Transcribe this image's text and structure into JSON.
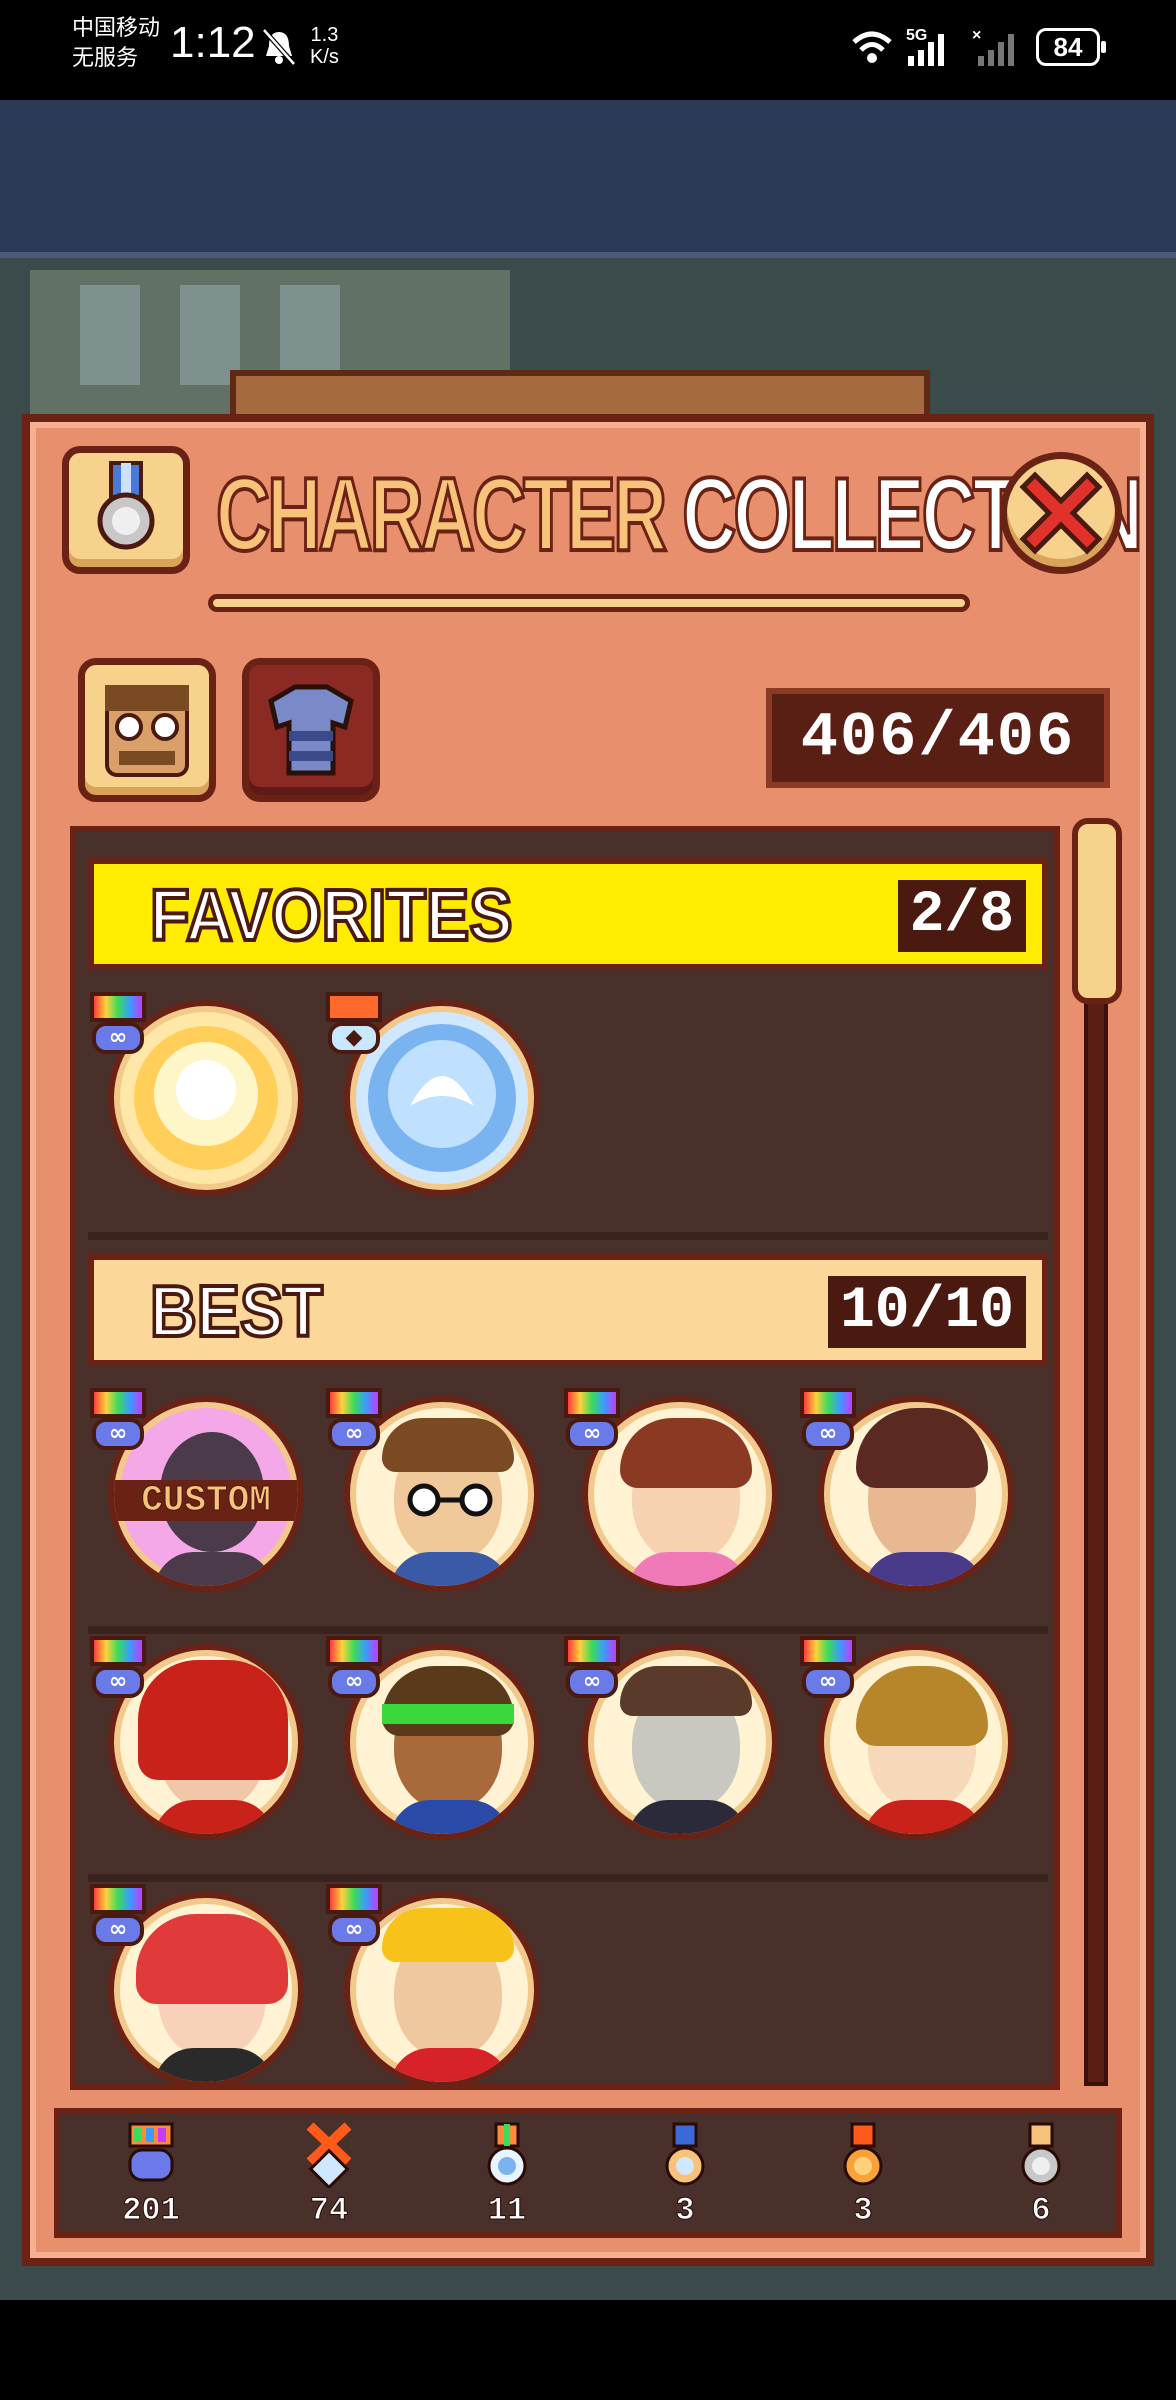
{
  "status_bar": {
    "carrier_line1": "中国移动",
    "carrier_line2": "无服务",
    "time": "1:12",
    "net_speed_value": "1.3",
    "net_speed_unit": "K/s",
    "network": "5G",
    "battery": "84"
  },
  "panel": {
    "title_part1": "CHARACTER",
    "title_part2": "COLLECTION",
    "collection_count": "406/406",
    "tabs": [
      {
        "name": "characters",
        "icon": "glasses-face-icon"
      },
      {
        "name": "outfits",
        "icon": "shirt-icon"
      }
    ]
  },
  "favorites": {
    "label": "FAVORITES",
    "count": "2/8",
    "items": [
      {
        "id": "fav-1",
        "medal": "rainbow-infinity",
        "icon": "glowing-gold-orb-icon"
      },
      {
        "id": "fav-2",
        "medal": "orange-cross",
        "icon": "glowing-blue-orb-icon"
      }
    ]
  },
  "best": {
    "label": "BEST",
    "count": "10/10",
    "custom_label": "CUSTOM",
    "items": [
      {
        "id": "custom",
        "medal": "rainbow-infinity"
      },
      {
        "id": "glasses-man",
        "medal": "rainbow-infinity"
      },
      {
        "id": "ponytail-girl",
        "medal": "rainbow-infinity"
      },
      {
        "id": "gunslinger",
        "medal": "rainbow-infinity"
      },
      {
        "id": "red-hood",
        "medal": "rainbow-infinity"
      },
      {
        "id": "headband-woman",
        "medal": "rainbow-infinity"
      },
      {
        "id": "zombie",
        "medal": "rainbow-infinity"
      },
      {
        "id": "blonde-girl",
        "medal": "rainbow-infinity"
      },
      {
        "id": "red-hair-girl",
        "medal": "rainbow-infinity"
      },
      {
        "id": "yellow-cap-guy",
        "medal": "rainbow-infinity"
      }
    ]
  },
  "tally": [
    {
      "medal": "rainbow-infinity",
      "count": "201"
    },
    {
      "medal": "orange-cross",
      "count": "74"
    },
    {
      "medal": "diamond",
      "count": "11"
    },
    {
      "medal": "blue-gem",
      "count": "3"
    },
    {
      "medal": "bronze",
      "count": "3"
    },
    {
      "medal": "silver",
      "count": "6"
    }
  ],
  "colors": {
    "panel": "#e88f6e",
    "border": "#6a2215",
    "favorites_header": "#ffec00",
    "best_header": "#fbd79a",
    "list_bg": "#4a302b"
  }
}
